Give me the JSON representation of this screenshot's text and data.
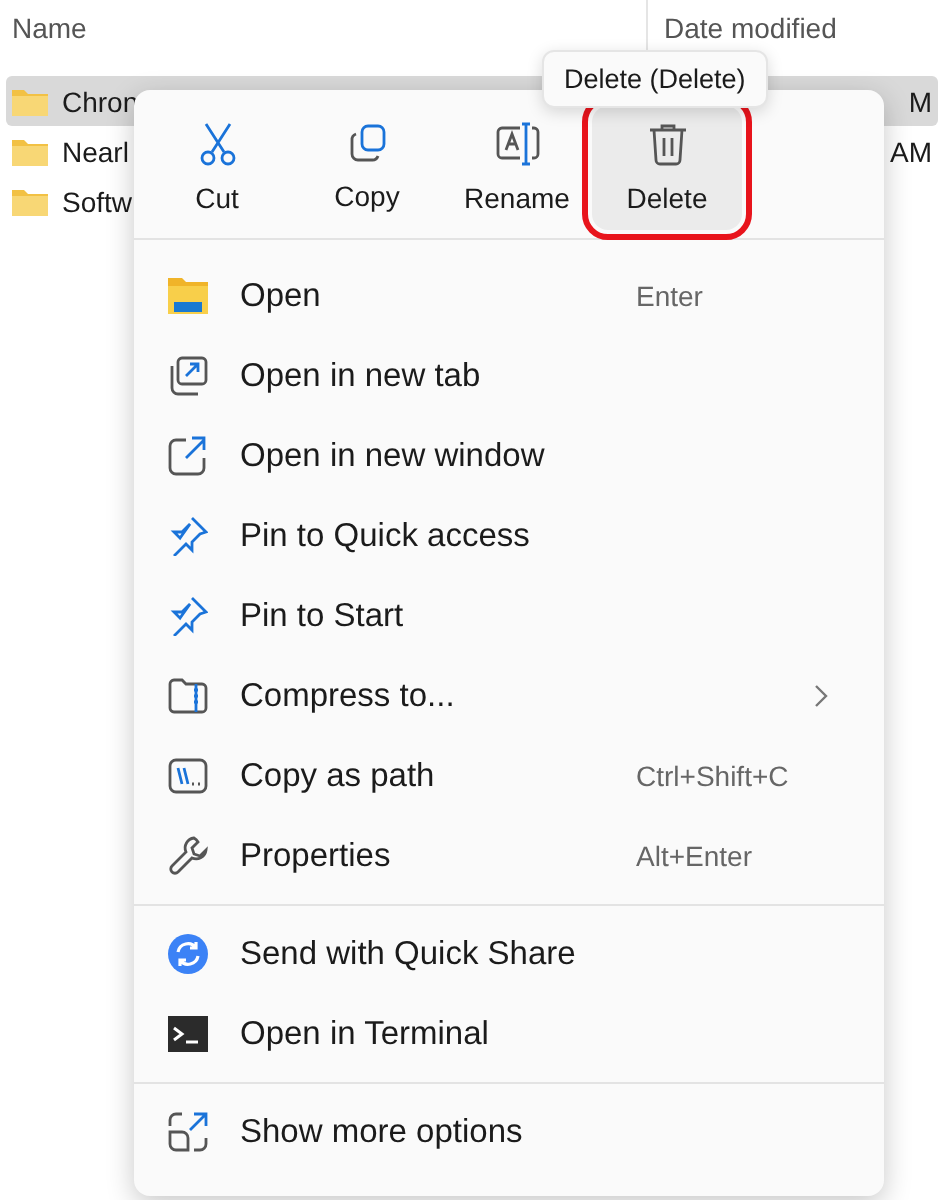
{
  "file_list": {
    "columns": [
      "Name",
      "Date modified"
    ],
    "rows": [
      {
        "name": "Chron",
        "date": "M",
        "selected": true
      },
      {
        "name": "Nearl",
        "date": "AM",
        "selected": false
      },
      {
        "name": "Softw",
        "date": "",
        "selected": false
      }
    ]
  },
  "tooltip": "Delete (Delete)",
  "context_menu": {
    "toolbar": [
      {
        "label": "Cut",
        "selected": false,
        "highlighted": false
      },
      {
        "label": "Copy",
        "selected": false,
        "highlighted": false
      },
      {
        "label": "Rename",
        "selected": false,
        "highlighted": false
      },
      {
        "label": "Delete",
        "selected": true,
        "highlighted": true
      }
    ],
    "groups": [
      [
        {
          "label": "Open",
          "shortcut": "Enter"
        },
        {
          "label": "Open in new tab"
        },
        {
          "label": "Open in new window"
        },
        {
          "label": "Pin to Quick access"
        },
        {
          "label": "Pin to Start"
        },
        {
          "label": "Compress to...",
          "submenu": true
        },
        {
          "label": "Copy as path",
          "shortcut": "Ctrl+Shift+C"
        },
        {
          "label": "Properties",
          "shortcut": "Alt+Enter"
        }
      ],
      [
        {
          "label": "Send with Quick Share"
        },
        {
          "label": "Open in Terminal"
        }
      ],
      [
        {
          "label": "Show more options"
        }
      ]
    ]
  }
}
